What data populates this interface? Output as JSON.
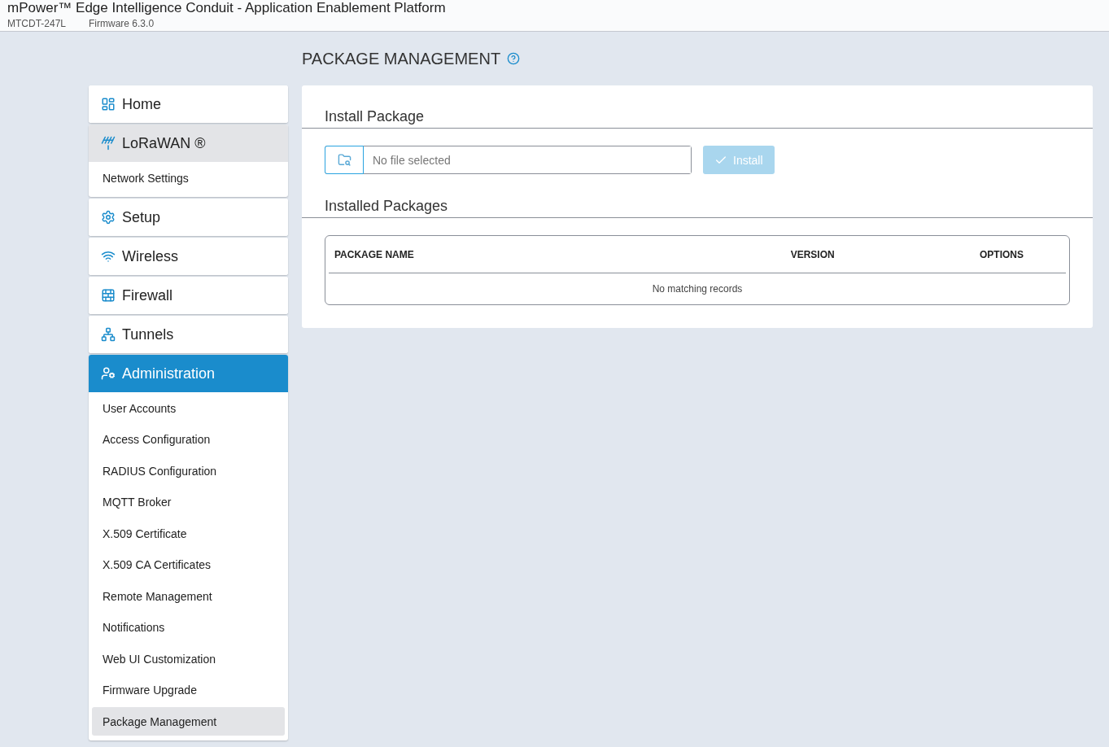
{
  "header": {
    "title": "mPower™ Edge Intelligence Conduit - Application Enablement Platform",
    "model": "MTCDT-247L",
    "firmware": "Firmware 6.3.0"
  },
  "sidebar": [
    {
      "label": "Home",
      "expanded": false,
      "selected": false
    },
    {
      "label": "LoRaWAN ®",
      "expanded": true,
      "selected": false,
      "children": [
        {
          "label": "Network Settings",
          "selected": false
        }
      ]
    },
    {
      "label": "Setup",
      "expanded": false,
      "selected": false
    },
    {
      "label": "Wireless",
      "expanded": false,
      "selected": false
    },
    {
      "label": "Firewall",
      "expanded": false,
      "selected": false
    },
    {
      "label": "Tunnels",
      "expanded": false,
      "selected": false
    },
    {
      "label": "Administration",
      "expanded": true,
      "selected": true,
      "children": [
        {
          "label": "User Accounts",
          "selected": false
        },
        {
          "label": "Access Configuration",
          "selected": false
        },
        {
          "label": "RADIUS Configuration",
          "selected": false
        },
        {
          "label": "MQTT Broker",
          "selected": false
        },
        {
          "label": "X.509 Certificate",
          "selected": false
        },
        {
          "label": "X.509 CA Certificates",
          "selected": false
        },
        {
          "label": "Remote Management",
          "selected": false
        },
        {
          "label": "Notifications",
          "selected": false
        },
        {
          "label": "Web UI Customization",
          "selected": false
        },
        {
          "label": "Firmware Upgrade",
          "selected": false
        },
        {
          "label": "Package Management",
          "selected": true
        }
      ]
    }
  ],
  "page": {
    "title": "PACKAGE MANAGEMENT",
    "install": {
      "heading": "Install Package",
      "file_placeholder": "No file selected",
      "button": "Install",
      "button_disabled": true
    },
    "installed": {
      "heading": "Installed Packages",
      "columns": [
        "PACKAGE NAME",
        "VERSION",
        "OPTIONS"
      ],
      "empty": "No matching records"
    }
  }
}
